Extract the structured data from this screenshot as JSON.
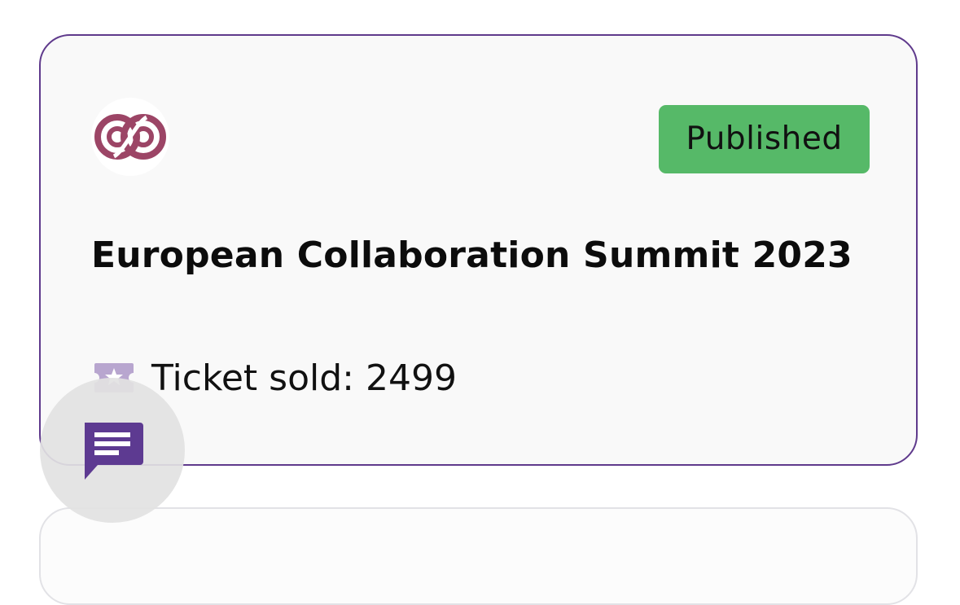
{
  "event_card": {
    "status": "Published",
    "title": "European Collaboration Summit 2023",
    "tickets_label": "Ticket sold:",
    "tickets_sold": 2499,
    "tickets_text": "Ticket sold: 2499",
    "logo_icon": "infinity-logo-icon",
    "ticket_icon": "ticket-star-icon"
  },
  "chat": {
    "icon": "chat-bubble-icon"
  },
  "colors": {
    "card_border": "#5f3a8c",
    "status_badge": "#56b968",
    "logo": "#9c4566",
    "ticket_icon": "#b8a6cf",
    "chat_icon": "#5d3a91",
    "chat_fab_bg": "#e2e2e2"
  }
}
